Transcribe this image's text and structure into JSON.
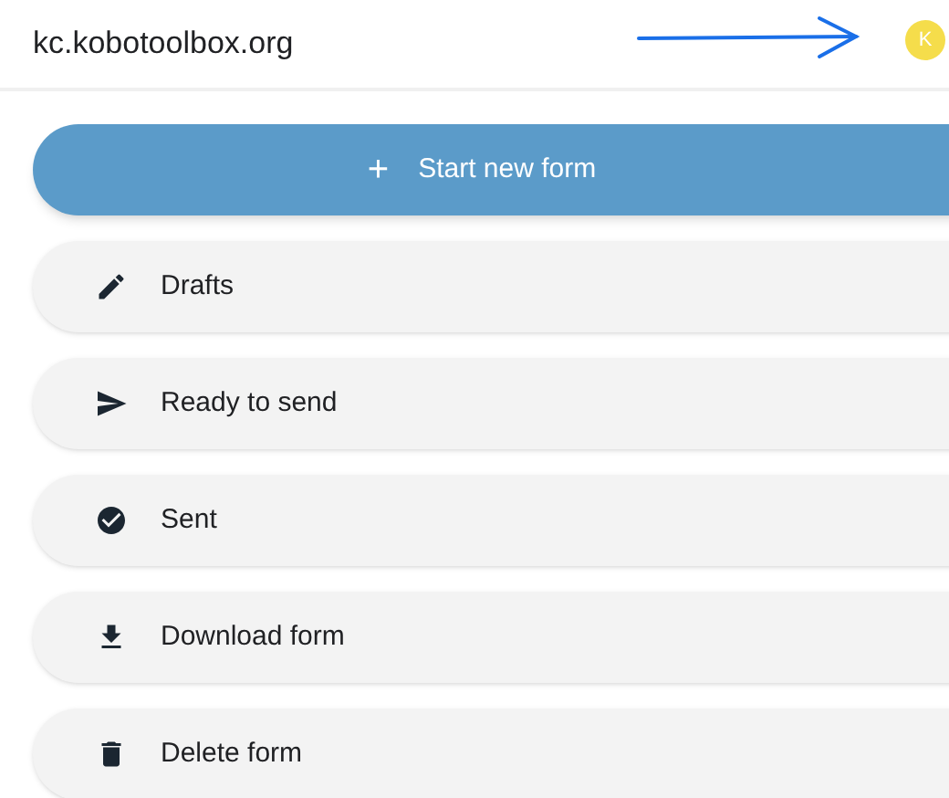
{
  "header": {
    "title": "kc.kobotoolbox.org",
    "avatar": "K"
  },
  "primary_button": {
    "icon": "+",
    "label": "Start new form"
  },
  "menu_items": [
    {
      "kind": "pencil",
      "label": "Drafts"
    },
    {
      "kind": "send",
      "label": "Ready to send"
    },
    {
      "kind": "check",
      "label": "Sent"
    },
    {
      "kind": "download",
      "label": "Download form"
    },
    {
      "kind": "trash",
      "label": "Delete form"
    }
  ]
}
